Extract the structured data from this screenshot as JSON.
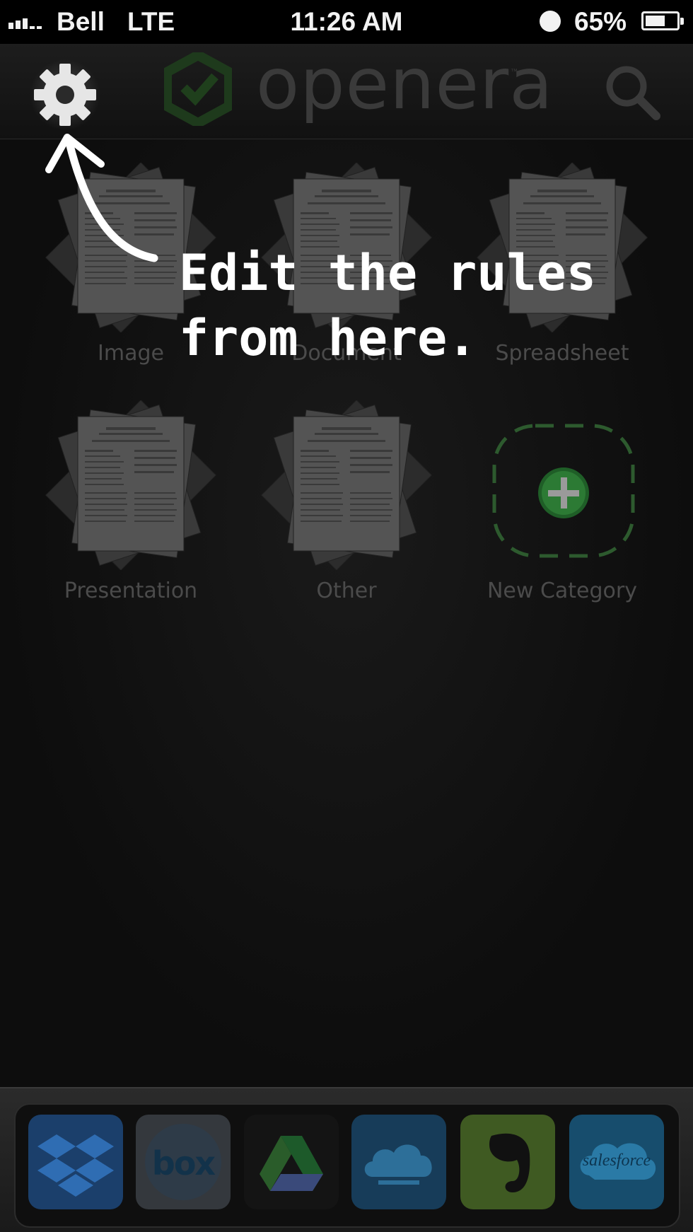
{
  "status_bar": {
    "carrier": "Bell",
    "network": "LTE",
    "time": "11:26 AM",
    "battery": "65%",
    "battery_level": 0.65
  },
  "header": {
    "logo_text": "openera",
    "logo_tm": "™",
    "settings_icon": "gear-icon",
    "search_icon": "search-icon"
  },
  "annotation": {
    "line1": "Edit the rules",
    "line2": "from here."
  },
  "categories": [
    {
      "label": "Image"
    },
    {
      "label": "Document"
    },
    {
      "label": "Spreadsheet"
    },
    {
      "label": "Presentation"
    },
    {
      "label": "Other"
    },
    {
      "label": "New Category"
    }
  ],
  "dock": {
    "apps": [
      {
        "name": "Dropbox",
        "icon": "dropbox-icon",
        "color": "#1c4f8c"
      },
      {
        "name": "box",
        "label": "box",
        "icon": "box-icon",
        "color": "#3b3f46"
      },
      {
        "name": "Google Drive",
        "icon": "google-drive-icon",
        "color": "#161616"
      },
      {
        "name": "SkyDrive",
        "icon": "skydrive-icon",
        "color": "#1f4d6e"
      },
      {
        "name": "Evernote",
        "icon": "evernote-icon",
        "color": "#4d6b2a"
      },
      {
        "name": "salesforce",
        "label": "salesforce",
        "icon": "salesforce-icon",
        "color": "#1d5f85"
      }
    ]
  },
  "colors": {
    "background": "#0c0c0c",
    "accent_green": "#2f8a3a",
    "annotation": "#ffffff"
  }
}
